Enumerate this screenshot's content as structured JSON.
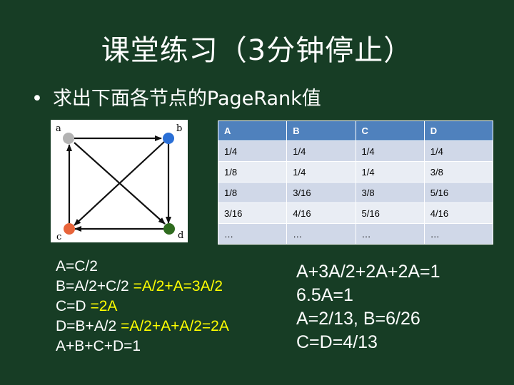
{
  "title": "课堂练习（3分钟停止）",
  "bullet": {
    "symbol": "•",
    "text": "求出下面各节点的PageRank值"
  },
  "graph": {
    "nodes": [
      {
        "label": "a",
        "color": "#b3b3b3"
      },
      {
        "label": "b",
        "color": "#2a6fd6"
      },
      {
        "label": "c",
        "color": "#e8643a"
      },
      {
        "label": "d",
        "color": "#2f6b1f"
      }
    ],
    "edges": [
      [
        "a",
        "b"
      ],
      [
        "a",
        "d"
      ],
      [
        "b",
        "d"
      ],
      [
        "b",
        "c"
      ],
      [
        "c",
        "a"
      ],
      [
        "d",
        "c"
      ]
    ]
  },
  "table": {
    "headers": [
      "A",
      "B",
      "C",
      "D"
    ],
    "rows": [
      [
        "1/4",
        "1/4",
        "1/4",
        "1/4"
      ],
      [
        "1/8",
        "1/4",
        "1/4",
        "3/8"
      ],
      [
        "1/8",
        "3/16",
        "3/8",
        "5/16"
      ],
      [
        "3/16",
        "4/16",
        "5/16",
        "4/16"
      ],
      [
        "…",
        "…",
        "…",
        "…"
      ]
    ]
  },
  "equations": [
    {
      "main": "A=C/2",
      "highlight": ""
    },
    {
      "main": "B=A/2+C/2 ",
      "highlight": "=A/2+A=3A/2"
    },
    {
      "main": "C=D ",
      "highlight": "=2A"
    },
    {
      "main": "D=B+A/2 ",
      "highlight": "=A/2+A+A/2=2A"
    },
    {
      "main": "A+B+C+D=1",
      "highlight": ""
    }
  ],
  "solution": [
    "A+3A/2+2A+2A=1",
    "6.5A=1",
    "A=2/13, B=6/26",
    "C=D=4/13"
  ],
  "colors": {
    "background": "#173d25",
    "highlight": "#ffff00",
    "table_header": "#4f81bd"
  }
}
